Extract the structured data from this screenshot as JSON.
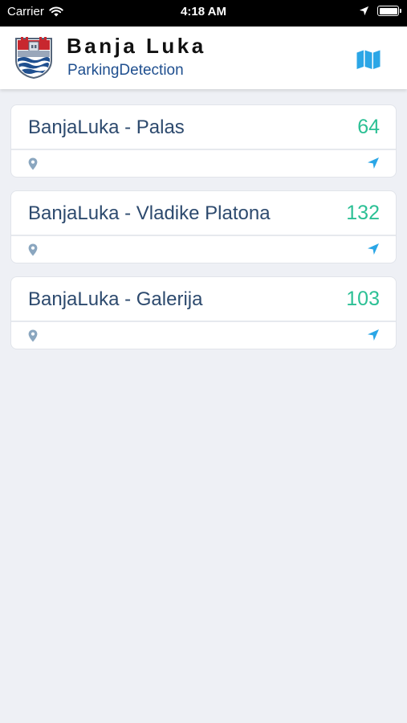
{
  "status_bar": {
    "carrier": "Carrier",
    "time": "4:18 AM"
  },
  "header": {
    "title": "Banja Luka",
    "subtitle": "ParkingDetection",
    "logo_icon": "banja-luka-coat-of-arms",
    "map_icon": "map-icon"
  },
  "colors": {
    "title": "#111111",
    "subtitle": "#1f4f8f",
    "location_name": "#2d4a6e",
    "free_count": "#2cc095",
    "icon_blue": "#2ba6e6",
    "pin": "#8aa6bf",
    "background": "#eef0f5"
  },
  "parkings": [
    {
      "name": "BanjaLuka - Palas",
      "count": "64"
    },
    {
      "name": "BanjaLuka - Vladike Platona",
      "count": "132"
    },
    {
      "name": "BanjaLuka - Galerija",
      "count": "103"
    }
  ]
}
